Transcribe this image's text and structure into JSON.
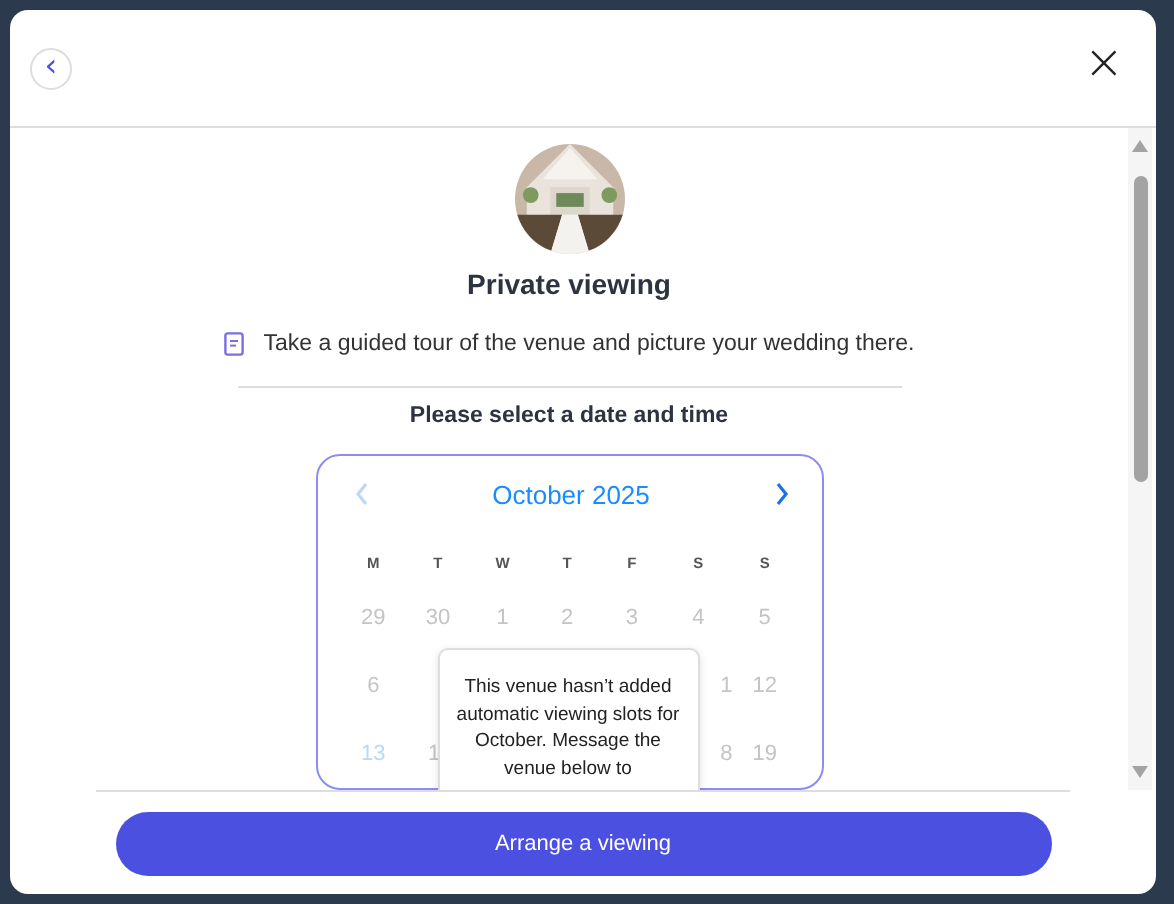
{
  "header": {
    "back_button": "‹",
    "close_button": "×"
  },
  "title": "Private viewing",
  "description": "Take a guided tour of the venue and picture your wedding there.",
  "prompt": "Please select a date and time",
  "calendar": {
    "month": "October  2025",
    "prev_disabled": true,
    "next_disabled": false,
    "weekdays": [
      "M",
      "T",
      "W",
      "T",
      "F",
      "S",
      "S"
    ],
    "weeks": [
      {
        "left": [
          {
            "day": "29",
            "kind": "muted"
          },
          {
            "day": "30",
            "kind": "muted"
          },
          {
            "day": "1",
            "kind": "muted"
          },
          {
            "day": "2",
            "kind": "muted"
          },
          {
            "day": "3",
            "kind": "muted"
          },
          {
            "day": "4",
            "kind": "muted"
          },
          {
            "day": "5",
            "kind": "muted"
          }
        ]
      },
      {
        "left": [
          {
            "day": "6",
            "kind": "muted"
          }
        ],
        "right": [
          {
            "day": "1",
            "kind": "cutleft"
          },
          {
            "day": "12",
            "kind": "muted"
          }
        ]
      },
      {
        "left": [
          {
            "day": "13",
            "kind": "today"
          },
          {
            "day": "1",
            "kind": "cutright"
          }
        ],
        "right": [
          {
            "day": "8",
            "kind": "cutleft"
          },
          {
            "day": "19",
            "kind": "muted"
          }
        ]
      }
    ],
    "tooltip": "This venue hasn’t added automatic viewing slots for October. Message the venue below to"
  },
  "footer": {
    "button": "Arrange a viewing"
  }
}
